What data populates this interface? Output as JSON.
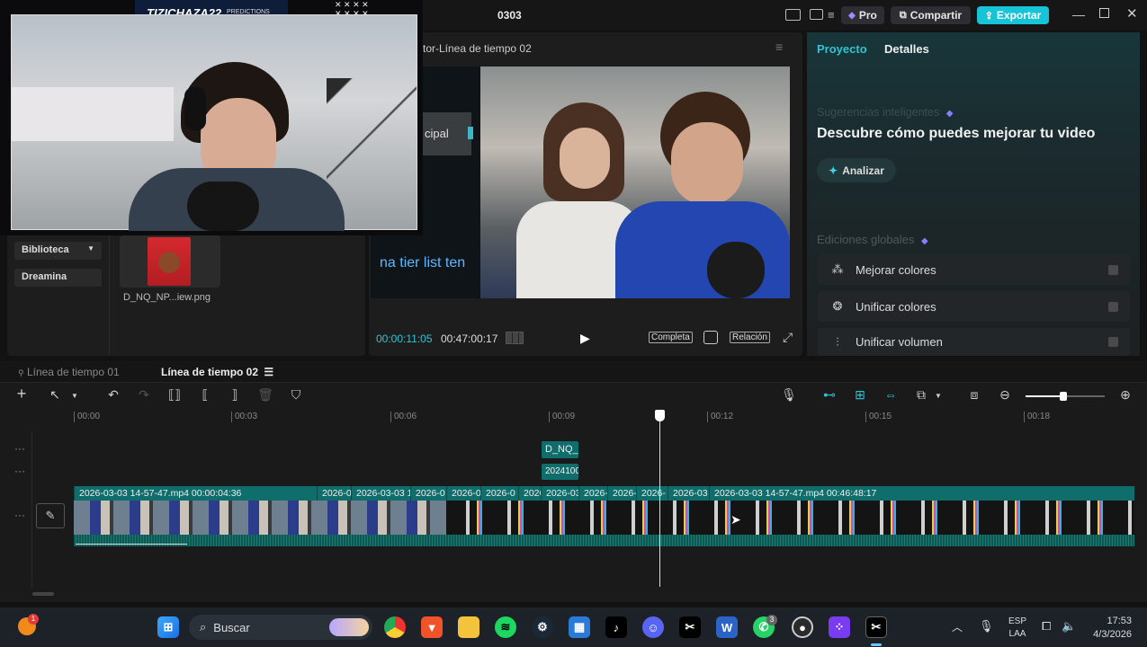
{
  "window": {
    "title": "0303",
    "pro_label": "Pro",
    "share_label": "Compartir",
    "export_label": "Exportar"
  },
  "overlay": {
    "channel_name": "TIZICHAZA22",
    "channel_sub": "PREDICTIONS"
  },
  "player": {
    "title": "tor-Línea de tiempo 02",
    "partial_label": "cipal",
    "caption_partial": "na tier list ten",
    "current_time": "00:00:11:05",
    "total_time": "00:47:00:17",
    "btn_full": "Completa",
    "btn_ratio": "Relación"
  },
  "media": {
    "library_label": "Biblioteca",
    "dreamina_label": "Dreamina",
    "file_name": "D_NQ_NP...iew.png"
  },
  "right_panel": {
    "tab_project": "Proyecto",
    "tab_details": "Detalles",
    "suggestions_title": "Sugerencias inteligentes",
    "headline": "Descubre cómo puedes mejorar tu video",
    "analyze_label": "Analizar",
    "global_edits_title": "Ediciones globales",
    "options": [
      {
        "label": "Mejorar colores",
        "icon": "sparkle-wand-icon"
      },
      {
        "label": "Unificar colores",
        "icon": "palette-icon"
      },
      {
        "label": "Unificar volumen",
        "icon": "sliders-icon"
      }
    ]
  },
  "timeline": {
    "tabs": [
      "Línea de tiempo 01",
      "Línea de tiempo 02"
    ],
    "ruler": [
      "00:00",
      "00:03",
      "00:06",
      "00:09",
      "00:12",
      "00:15",
      "00:18"
    ],
    "overlay_clip1": "D_NQ_",
    "overlay_clip2": "2024100",
    "clips": [
      "2026-03-03 14-57-47.mp4   00:00:04:36",
      "2026-0",
      "2026-03-03 1",
      "2026-0",
      "2026-0",
      "2026-0",
      "2026",
      "2026-03",
      "2026-",
      "2026-",
      "2026-",
      "2026-03",
      "2026-03-03 14-57-47.mp4   00:46:48:17"
    ]
  },
  "taskbar": {
    "search_placeholder": "Buscar",
    "lang_top": "ESP",
    "lang_bottom": "LAA",
    "time": "17:53",
    "date": "4/3/2026",
    "notif_badge": "1",
    "whatsapp_badge": "3"
  },
  "colors": {
    "accent": "#00c1cd",
    "clip_teal": "#0f6e6b",
    "export_bg": "#17c3d6"
  }
}
